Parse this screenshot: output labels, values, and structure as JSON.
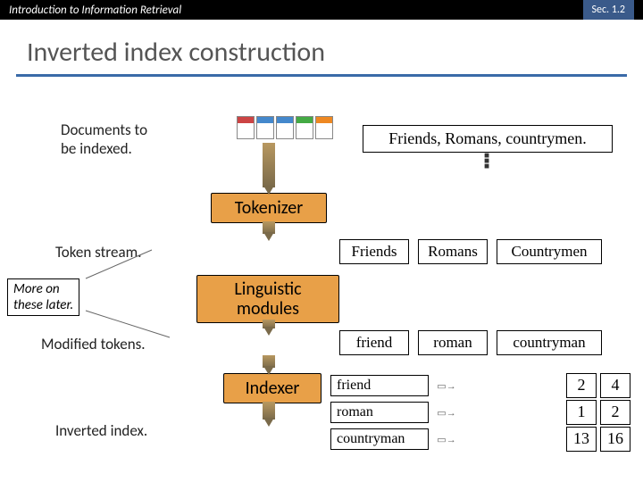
{
  "header": {
    "course": "Introduction to Information Retrieval",
    "section": "Sec. 1.2"
  },
  "title": "Inverted index construction",
  "stages": {
    "documents": "Documents to\nbe indexed.",
    "token_stream": "Token stream.",
    "modified": "Modified tokens.",
    "inverted": "Inverted index.",
    "note": "More on\nthese later."
  },
  "doc_content": "Friends, Romans, countrymen.",
  "processes": {
    "tokenizer": "Tokenizer",
    "linguistic": "Linguistic\nmodules",
    "indexer": "Indexer"
  },
  "tokens_raw": [
    "Friends",
    "Romans",
    "Countrymen"
  ],
  "tokens_mod": [
    "friend",
    "roman",
    "countryman"
  ],
  "index": [
    {
      "term": "friend",
      "postings": [
        2,
        4
      ]
    },
    {
      "term": "roman",
      "postings": [
        1,
        2
      ]
    },
    {
      "term": "countryman",
      "postings": [
        13,
        16
      ]
    }
  ]
}
